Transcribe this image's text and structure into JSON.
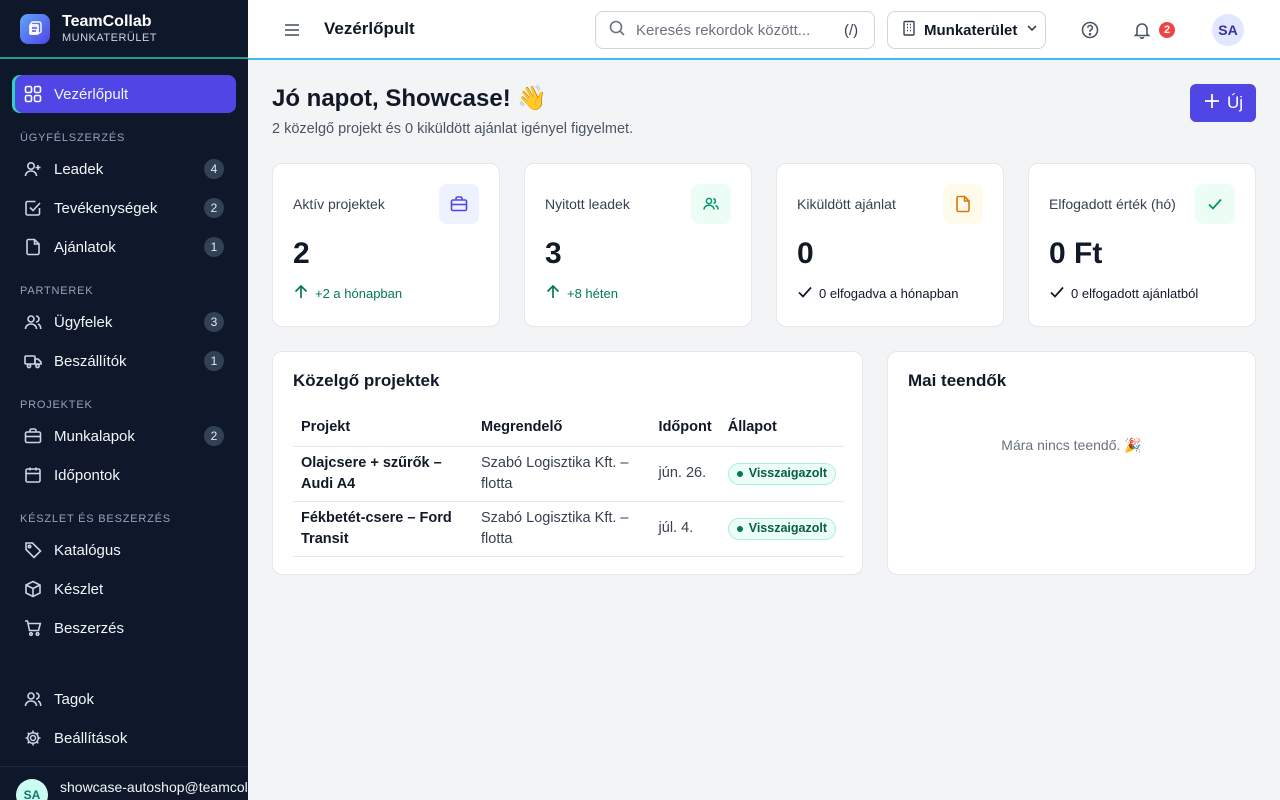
{
  "app": {
    "name": "TeamCollab",
    "workspace_label": "MUNKATERÜLET"
  },
  "sidebar": {
    "dashboard": {
      "label": "Vezérlőpult",
      "icon": "grid-icon"
    },
    "sections": [
      {
        "title": "ÜGYFÉLSZERZÉS",
        "items": [
          {
            "label": "Leadek",
            "badge": "4",
            "icon": "user-plus-icon"
          },
          {
            "label": "Tevékenységek",
            "badge": "2",
            "icon": "check-square-icon"
          },
          {
            "label": "Ajánlatok",
            "badge": "1",
            "icon": "file-icon"
          }
        ]
      },
      {
        "title": "PARTNEREK",
        "items": [
          {
            "label": "Ügyfelek",
            "badge": "3",
            "icon": "users-icon"
          },
          {
            "label": "Beszállítók",
            "badge": "1",
            "icon": "truck-icon"
          }
        ]
      },
      {
        "title": "PROJEKTEK",
        "items": [
          {
            "label": "Munkalapok",
            "badge": "2",
            "icon": "briefcase-icon"
          },
          {
            "label": "Időpontok",
            "badge": "",
            "icon": "calendar-icon"
          }
        ]
      },
      {
        "title": "KÉSZLET ÉS BESZERZÉS",
        "items": [
          {
            "label": "Katalógus",
            "badge": "",
            "icon": "tag-icon"
          },
          {
            "label": "Készlet",
            "badge": "",
            "icon": "box-icon"
          },
          {
            "label": "Beszerzés",
            "badge": "",
            "icon": "cart-icon"
          }
        ]
      }
    ],
    "bottom": [
      {
        "label": "Tagok",
        "icon": "users-icon"
      },
      {
        "label": "Beállítások",
        "icon": "gear-icon"
      }
    ],
    "user": {
      "initials": "SA",
      "email": "showcase-autoshop@teamcol"
    }
  },
  "header": {
    "title": "Vezérlőpult",
    "search_placeholder": "Keresés rekordok között...",
    "search_shortcut": "(/)",
    "workspace_select": "Munkaterület",
    "notifications_count": "2",
    "avatar_initials": "SA"
  },
  "main": {
    "greeting": "Jó napot, Showcase! 👋",
    "subtitle": "2 közelgő projekt és 0 kiküldött ajánlat igényel figyelmet.",
    "new_button": "Új",
    "kpis": [
      {
        "label": "Aktív projektek",
        "value": "2",
        "foot": "+2 a hónapban",
        "trend": "up",
        "icon": "briefcase-icon",
        "icon_bg": "#eef2ff",
        "icon_color": "#4f46e5"
      },
      {
        "label": "Nyitott leadek",
        "value": "3",
        "foot": "+8 héten",
        "trend": "up",
        "icon": "users-icon",
        "icon_bg": "#ecfdf5",
        "icon_color": "#059669"
      },
      {
        "label": "Kiküldött ajánlat",
        "value": "0",
        "foot": "0 elfogadva a hónapban",
        "trend": "check",
        "icon": "file-icon",
        "icon_bg": "#fffbeb",
        "icon_color": "#d97706"
      },
      {
        "label": "Elfogadott érték (hó)",
        "value": "0 Ft",
        "foot": "0 elfogadott ajánlatból",
        "trend": "check",
        "icon": "check-icon",
        "icon_bg": "#ecfdf5",
        "icon_color": "#059669"
      }
    ],
    "upcoming": {
      "title": "Közelgő projektek",
      "columns": [
        "Projekt",
        "Megrendelő",
        "Időpont",
        "Állapot"
      ],
      "rows": [
        {
          "project": "Olajcsere + szűrők – Audi A4",
          "client": "Szabó Logisztika Kft. – flotta",
          "date": "jún. 26.",
          "status": "Visszaigazolt"
        },
        {
          "project": "Fékbetét-csere – Ford Transit",
          "client": "Szabó Logisztika Kft. – flotta",
          "date": "júl. 4.",
          "status": "Visszaigazolt"
        }
      ]
    },
    "today": {
      "title": "Mai teendők",
      "empty": "Mára nincs teendő. 🎉"
    }
  }
}
